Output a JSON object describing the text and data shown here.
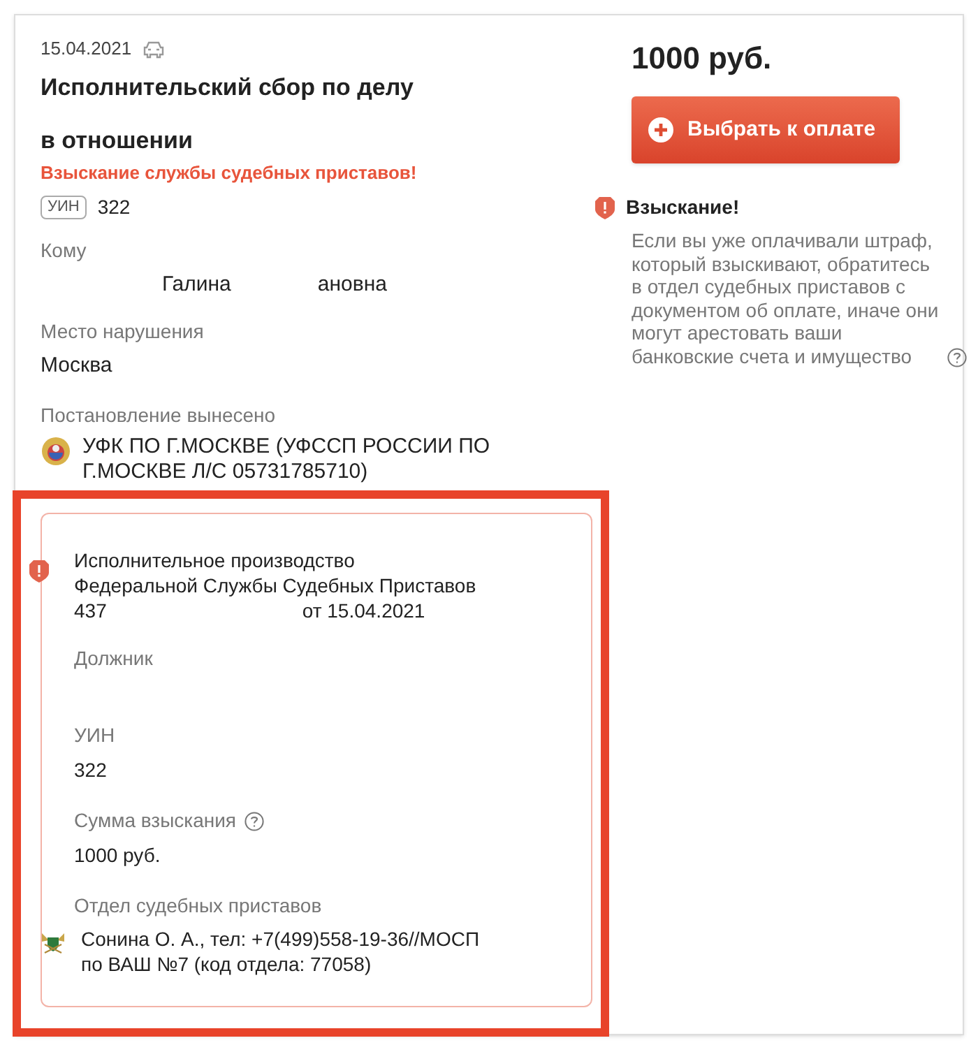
{
  "header": {
    "date": "15.04.2021",
    "title_lines": [
      "Исполнительский сбор по делу",
      "в отношении"
    ],
    "alert": "Взыскание службы судебных приставов!",
    "uin_badge": "УИН",
    "uin": "322"
  },
  "recipient": {
    "label": "Кому",
    "value_parts": [
      "Галина",
      "ановна"
    ]
  },
  "place": {
    "label": "Место нарушения",
    "value": "Москва"
  },
  "issuer": {
    "label": "Постановление вынесено",
    "value": "УФК ПО Г.МОСКВЕ (УФССП РОССИИ ПО Г.МОСКВЕ Л/С 05731785710)"
  },
  "enforcement": {
    "title_lines": [
      "Исполнительное производство",
      "Федеральной Службы Судебных Приставов"
    ],
    "number": "437",
    "date": "от 15.04.2021",
    "fields": [
      {
        "label": "Должник",
        "help": false
      },
      {
        "label": "УИН",
        "value": "322",
        "help": false
      },
      {
        "label": "Сумма взыскания",
        "value": "1000 руб.",
        "help": true
      }
    ],
    "department": {
      "label": "Отдел судебных приставов",
      "value": "Сонина О. А., тел: +7(499)558-19-36//МОСП по ВАШ №7 (код отдела: 77058)"
    }
  },
  "amount": "1000 руб.",
  "pay_button": "Выбрать к оплате",
  "warning": {
    "title": "Взыскание!",
    "text": "Если вы уже оплачивали штраф, который взыскивают, обратитесь в отдел судебных приставов с документом об оплате, иначе они могут арестовать ваши банковские счета и имущество"
  }
}
